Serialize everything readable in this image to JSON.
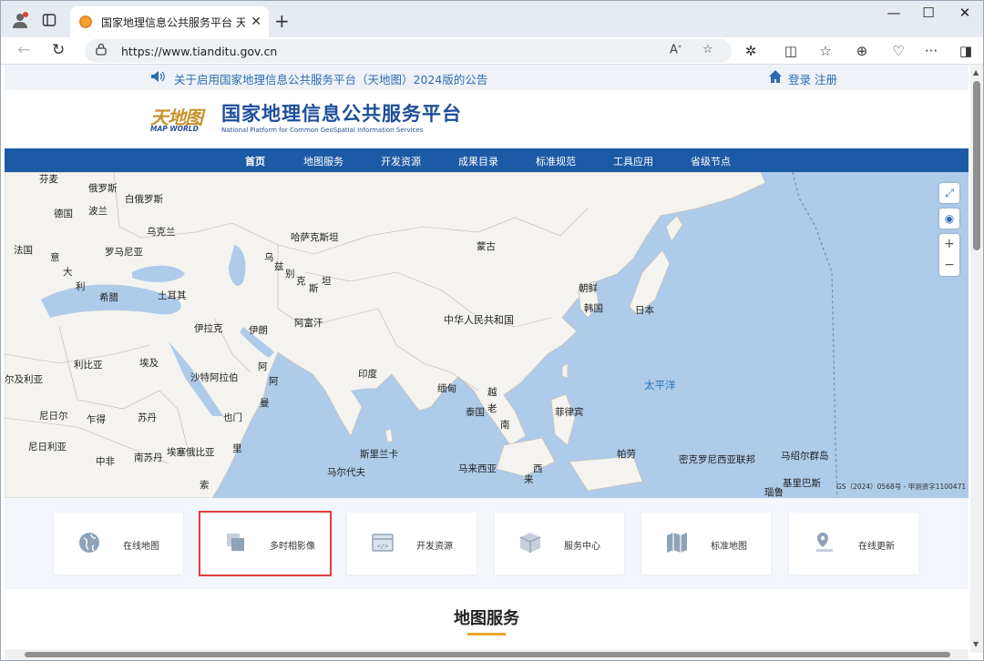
{
  "browser": {
    "tab_title": "国家地理信息公共服务平台 天地图",
    "url": "https://www.tianditu.gov.cn",
    "new_tab": "+",
    "controls": {
      "minimize": "—",
      "maximize": "☐",
      "close": "✕"
    }
  },
  "notice": {
    "text": "关于启用国家地理信息公共服务平台（天地图）2024版的公告",
    "login": "登录 注册"
  },
  "brand": {
    "logo_cn": "天地图",
    "logo_en": "MAP WORLD",
    "title": "国家地理信息公共服务平台",
    "subtitle": "National Platform for Common GeoSpatial Information Services"
  },
  "nav": {
    "items": [
      "首页",
      "地图服务",
      "开发资源",
      "成果目录",
      "标准规范",
      "工具应用",
      "省级节点"
    ],
    "active": "首页"
  },
  "map": {
    "labels": [
      "俄罗斯",
      "白俄罗斯",
      "德国",
      "波兰",
      "乌克兰",
      "法国",
      "罗马尼亚",
      "意",
      "大",
      "利",
      "希腊",
      "土耳其",
      "哈萨克斯坦",
      "蒙古",
      "乌",
      "兹",
      "别",
      "克",
      "斯",
      "坦",
      "朝鲜",
      "韩国",
      "日本",
      "伊拉克",
      "伊朗",
      "阿富汗",
      "中华人民共和国",
      "利比亚",
      "埃及",
      "沙特阿拉伯",
      "阿",
      "曼",
      "印度",
      "缅甸",
      "越",
      "泰国",
      "老",
      "菲律宾",
      "尔及利亚",
      "尼日尔",
      "乍得",
      "苏丹",
      "也门",
      "尼日利亚",
      "南苏丹",
      "埃塞俄比亚",
      "中非",
      "里",
      "索",
      "斯里兰卡",
      "马尔代夫",
      "马来西亚",
      "来",
      "西",
      "帕劳",
      "密克罗尼西亚联邦",
      "马绍尔群岛",
      "基里巴斯",
      "瑙鲁",
      "南",
      "芬麦"
    ],
    "ocean_label": "太平洋",
    "attribution": "GS（2024）0568号 - 甲测资字1100471"
  },
  "cards": [
    {
      "label": "在线地图",
      "icon": "globe-icon"
    },
    {
      "label": "多时相影像",
      "icon": "layers-icon",
      "highlighted": true
    },
    {
      "label": "开发资源",
      "icon": "code-window-icon"
    },
    {
      "label": "服务中心",
      "icon": "box-icon"
    },
    {
      "label": "标准地图",
      "icon": "folded-map-icon"
    },
    {
      "label": "在线更新",
      "icon": "location-pin-icon"
    }
  ],
  "section": {
    "title": "地图服务"
  },
  "colors": {
    "nav_blue": "#1c5aa6",
    "brand_blue": "#1f4e9b",
    "accent_gold": "#e7a72a",
    "highlight_red": "#e23d3d"
  }
}
